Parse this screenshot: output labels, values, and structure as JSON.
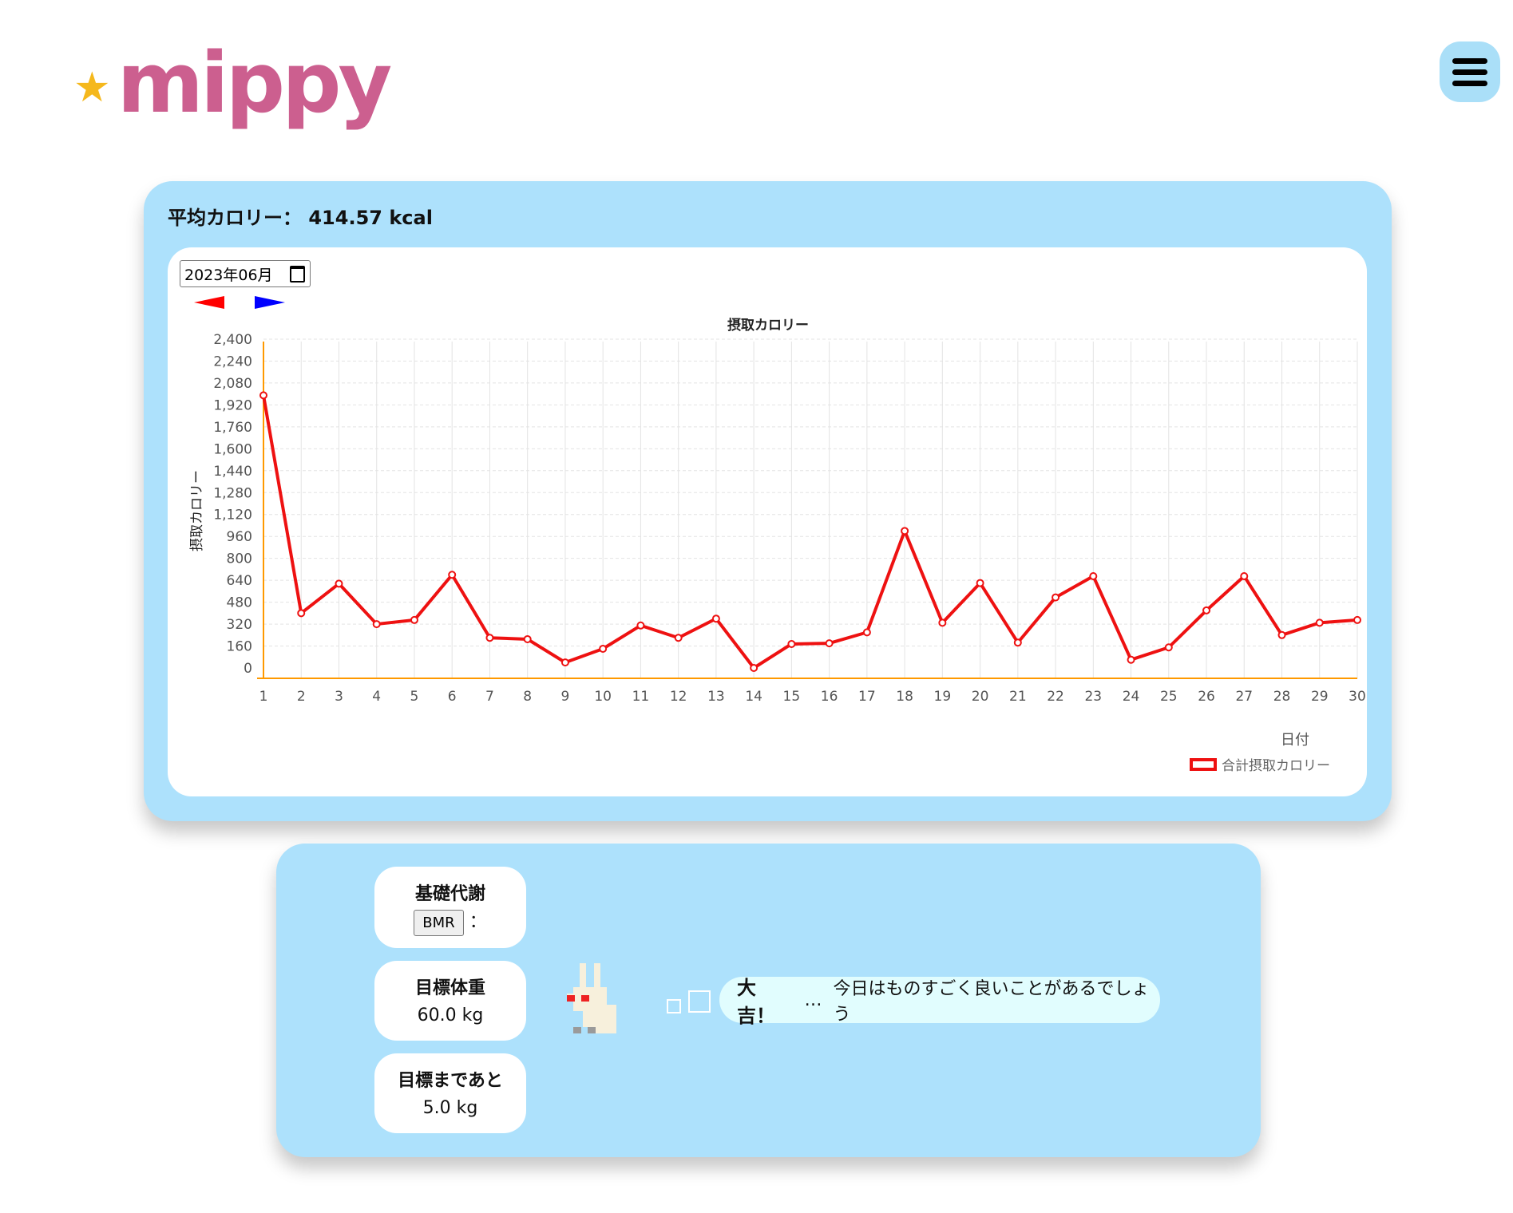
{
  "header": {
    "logo_text": "mippy",
    "logo_star": "★",
    "menu_icon": "hamburger-icon"
  },
  "summary": {
    "avg_label": "平均カロリー：",
    "avg_value": "414.57 kcal"
  },
  "controls": {
    "month_value": "2023年06月",
    "prev_color": "#ff0000",
    "next_color": "#0000ff"
  },
  "chart_data": {
    "type": "line",
    "title": "摂取カロリー",
    "xlabel": "日付",
    "ylabel": "摂取カロリー",
    "x": [
      1,
      2,
      3,
      4,
      5,
      6,
      7,
      8,
      9,
      10,
      11,
      12,
      13,
      14,
      15,
      16,
      17,
      18,
      19,
      20,
      21,
      22,
      23,
      24,
      25,
      26,
      27,
      28,
      29,
      30
    ],
    "ylim": [
      0,
      2400
    ],
    "yticks": [
      0,
      160,
      320,
      480,
      640,
      800,
      960,
      1120,
      1280,
      1440,
      1600,
      1760,
      1920,
      2080,
      2240,
      2400
    ],
    "ytick_labels": [
      "0",
      "160",
      "320",
      "480",
      "640",
      "800",
      "960",
      "1,120",
      "1,280",
      "1,440",
      "1,600",
      "1,760",
      "1,920",
      "2,080",
      "2,240",
      "2,400"
    ],
    "series": [
      {
        "name": "合計摂取カロリー",
        "color": "#ee1111",
        "values": [
          1990,
          400,
          615,
          320,
          350,
          680,
          220,
          210,
          40,
          140,
          310,
          220,
          360,
          0,
          175,
          180,
          260,
          1000,
          330,
          620,
          185,
          515,
          670,
          60,
          150,
          420,
          670,
          240,
          330,
          350
        ]
      }
    ],
    "axis_color": "#ff9900",
    "grid": true,
    "legend": "bottom-right"
  },
  "stats": {
    "bmr_title": "基礎代謝",
    "bmr_button": "BMR",
    "bmr_sep": "：",
    "target_weight_title": "目標体重",
    "target_weight_value": "60.0 kg",
    "remaining_title": "目標まであと",
    "remaining_value": "5.0 kg"
  },
  "fortune": {
    "luck": "大吉！",
    "dots": "…",
    "message": "今日はものすごく良いことがあるでしょう"
  }
}
